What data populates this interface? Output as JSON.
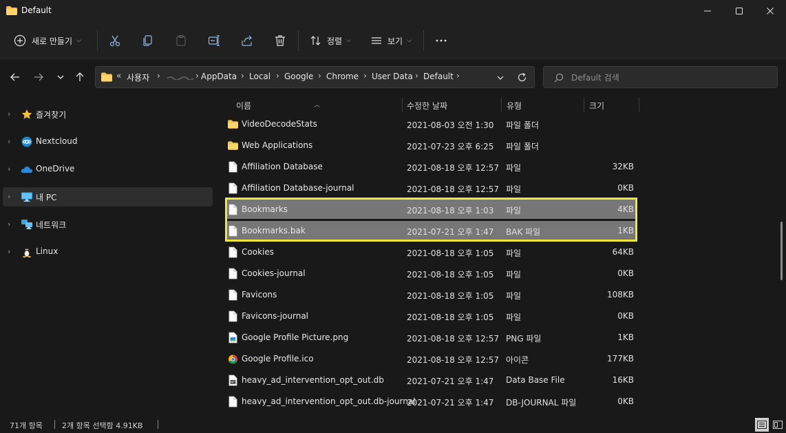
{
  "window": {
    "title": "Default"
  },
  "toolbar": {
    "new_label": "새로 만들기",
    "sort_label": "정렬",
    "view_label": "보기"
  },
  "address": {
    "crumbs": [
      "사용자",
      "AppData",
      "Local",
      "Google",
      "Chrome",
      "User Data",
      "Default"
    ],
    "overflow": "«"
  },
  "search": {
    "placeholder": "Default 검색"
  },
  "sidebar": {
    "items": [
      {
        "label": "즐겨찾기",
        "icon": "star-icon"
      },
      {
        "label": "Nextcloud",
        "icon": "nextcloud-icon"
      },
      {
        "label": "OneDrive",
        "icon": "onedrive-icon"
      },
      {
        "label": "내 PC",
        "icon": "pc-icon"
      },
      {
        "label": "네트워크",
        "icon": "network-icon"
      },
      {
        "label": "Linux",
        "icon": "linux-icon"
      }
    ]
  },
  "columns": {
    "name": "이름",
    "date": "수정한 날짜",
    "type": "유형",
    "size": "크기"
  },
  "files": [
    {
      "name": "VideoDecodeStats",
      "date": "2021-08-03 오전 1:30",
      "type": "파일 폴더",
      "size": "",
      "icon": "folder-icon"
    },
    {
      "name": "Web Applications",
      "date": "2021-07-23 오후 6:25",
      "type": "파일 폴더",
      "size": "",
      "icon": "folder-icon"
    },
    {
      "name": "Affiliation Database",
      "date": "2021-08-18 오후 12:57",
      "type": "파일",
      "size": "32KB",
      "icon": "file-icon"
    },
    {
      "name": "Affiliation Database-journal",
      "date": "2021-08-18 오후 12:57",
      "type": "파일",
      "size": "0KB",
      "icon": "file-icon"
    },
    {
      "name": "Bookmarks",
      "date": "2021-08-18 오후 1:03",
      "type": "파일",
      "size": "4KB",
      "icon": "file-icon",
      "selected": true
    },
    {
      "name": "Bookmarks.bak",
      "date": "2021-07-21 오후 1:47",
      "type": "BAK 파일",
      "size": "1KB",
      "icon": "file-icon",
      "selected": true
    },
    {
      "name": "Cookies",
      "date": "2021-08-18 오후 1:05",
      "type": "파일",
      "size": "64KB",
      "icon": "file-icon"
    },
    {
      "name": "Cookies-journal",
      "date": "2021-08-18 오후 1:05",
      "type": "파일",
      "size": "0KB",
      "icon": "file-icon"
    },
    {
      "name": "Favicons",
      "date": "2021-08-18 오후 1:05",
      "type": "파일",
      "size": "108KB",
      "icon": "file-icon"
    },
    {
      "name": "Favicons-journal",
      "date": "2021-08-18 오후 1:05",
      "type": "파일",
      "size": "0KB",
      "icon": "file-icon"
    },
    {
      "name": "Google Profile Picture.png",
      "date": "2021-08-18 오후 12:57",
      "type": "PNG 파일",
      "size": "1KB",
      "icon": "image-file-icon"
    },
    {
      "name": "Google Profile.ico",
      "date": "2021-08-18 오후 12:57",
      "type": "아이콘",
      "size": "177KB",
      "icon": "chrome-icon"
    },
    {
      "name": "heavy_ad_intervention_opt_out.db",
      "date": "2021-07-21 오후 1:47",
      "type": "Data Base File",
      "size": "16KB",
      "icon": "db-file-icon"
    },
    {
      "name": "heavy_ad_intervention_opt_out.db-journal",
      "date": "2021-07-21 오후 1:47",
      "type": "DB-JOURNAL 파일",
      "size": "0KB",
      "icon": "file-icon"
    }
  ],
  "status": {
    "item_count": "71개 항목",
    "selection": "2개 항목 선택함 4.91KB"
  }
}
